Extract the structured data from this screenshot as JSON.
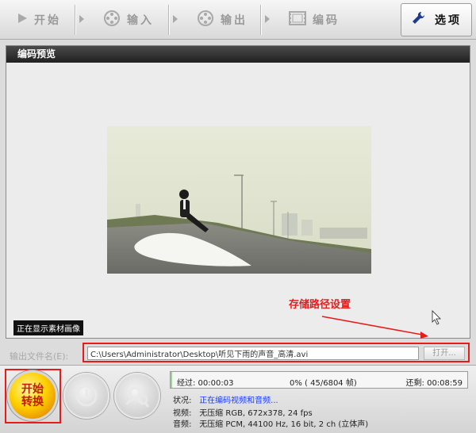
{
  "toolbar": {
    "start_label": "开始",
    "input_label": "输入",
    "output_label": "输出",
    "encode_label": "编码",
    "options_label": "选项"
  },
  "preview": {
    "title": "编码预览",
    "status_badge": "正在显示素材画像"
  },
  "annotation": {
    "text": "存储路径设置",
    "color": "#e81a1a"
  },
  "output": {
    "label": "输出文件名(E):",
    "path": "C:\\Users\\Administrator\\Desktop\\听见下雨的声音_高清.avi",
    "open_label": "打开..."
  },
  "actions": {
    "start_line1": "开始",
    "start_line2": "转换"
  },
  "progress": {
    "elapsed": "经过: 00:00:03",
    "percent": "0% ( 45/6804 帧)",
    "remaining": "还剩: 00:08:59",
    "fraction": 0.0066
  },
  "status": {
    "state_label": "状况:",
    "state_value": "正在编码视频和音频...",
    "video_label": "视频:",
    "video_value": "无压缩 RGB, 672x378, 24 fps",
    "audio_label": "音频:",
    "audio_value": "无压缩 PCM, 44100 Hz, 16 bit, 2 ch (立体声)"
  }
}
